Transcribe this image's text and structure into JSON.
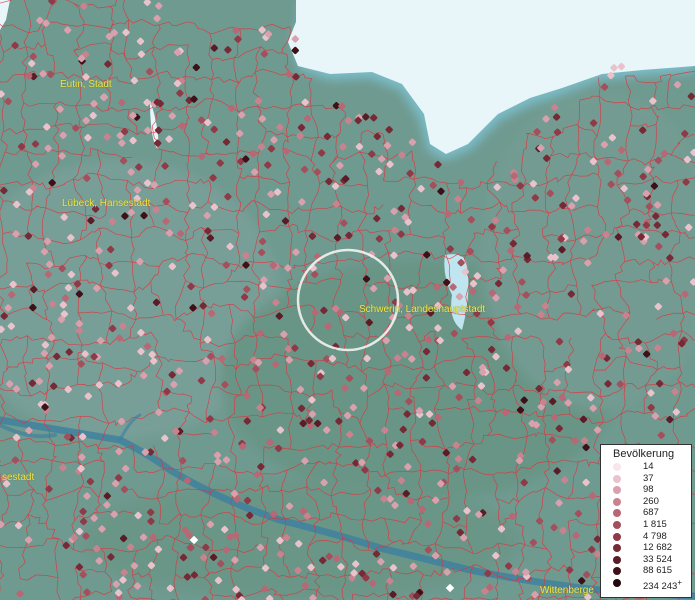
{
  "map": {
    "colors": {
      "land": "#6f9a90",
      "water": "#e8f6f9",
      "river": "#3a7ea0",
      "border": "#e0323c"
    },
    "places": [
      {
        "name": "Eutin, Stadt"
      },
      {
        "name": "Lübeck, Hansestadt"
      },
      {
        "name": "Schwerin, Landeshauptstadt"
      },
      {
        "name": "sestadt"
      },
      {
        "name": "Wittenberge"
      }
    ]
  },
  "legend": {
    "title": "Bevölkerung",
    "items": [
      {
        "label": "14",
        "color": "#f7e6ec"
      },
      {
        "label": "37",
        "color": "#e9c3cc"
      },
      {
        "label": "98",
        "color": "#d9a1ad"
      },
      {
        "label": "260",
        "color": "#c9838f"
      },
      {
        "label": "687",
        "color": "#b86874"
      },
      {
        "label": "1 815",
        "color": "#a44f5c"
      },
      {
        "label": "4 798",
        "color": "#8e3a47"
      },
      {
        "label": "12 682",
        "color": "#752a36"
      },
      {
        "label": "33 524",
        "color": "#5a1c27"
      },
      {
        "label": "88 615",
        "color": "#3e1119"
      },
      {
        "label": "234 243",
        "color": "#22070d"
      }
    ],
    "suffix": "+"
  }
}
